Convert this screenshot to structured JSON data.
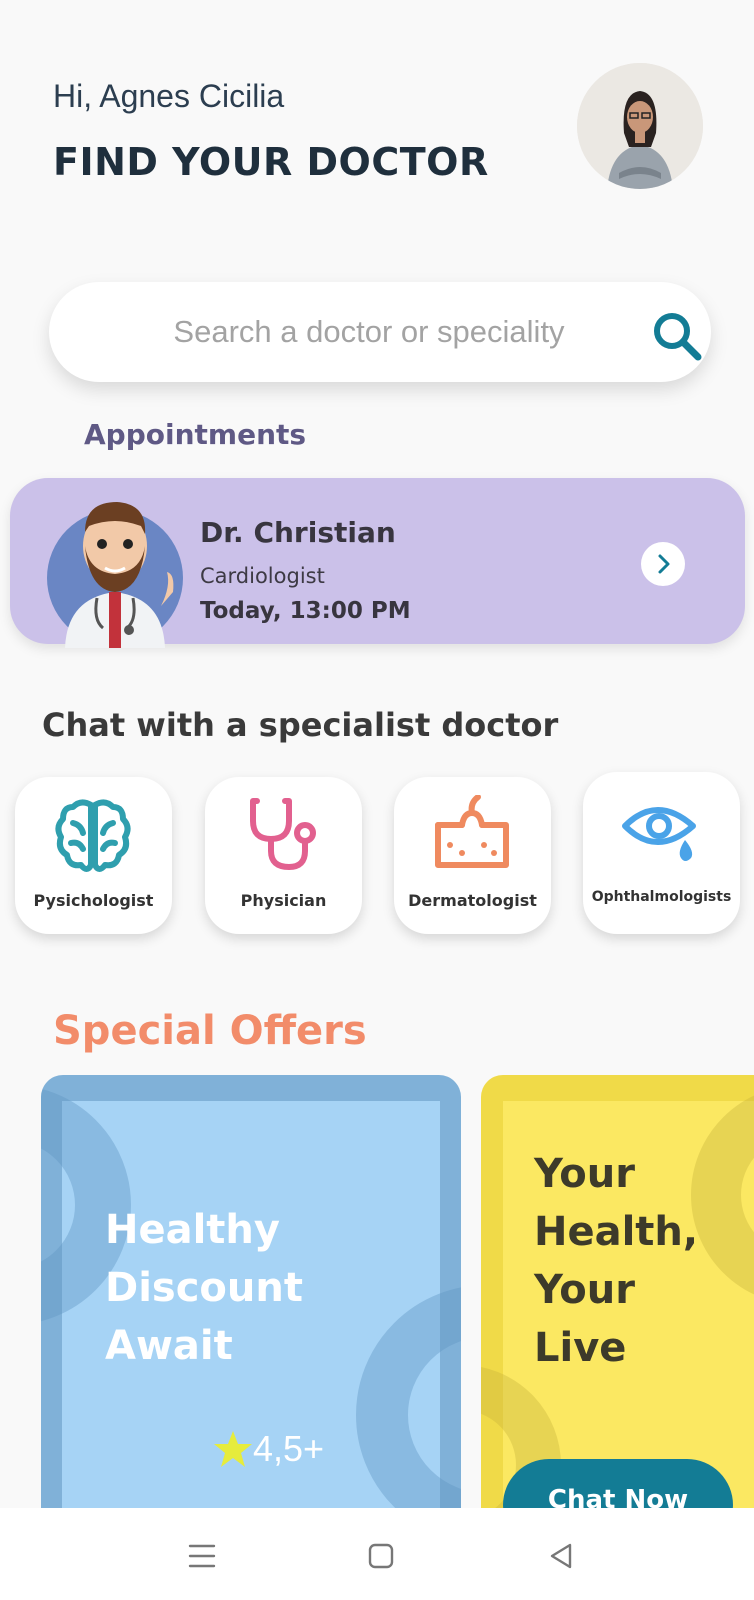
{
  "header": {
    "greeting": "Hi, Agnes Cicilia",
    "title": "FIND YOUR DOCTOR",
    "avatar_icon": "user-avatar"
  },
  "search": {
    "placeholder": "Search a doctor or speciality",
    "icon": "search-icon"
  },
  "appointments": {
    "heading": "Appointments",
    "card": {
      "doctor_name": "Dr. Christian",
      "speciality": "Cardiologist",
      "time": "Today, 13:00 PM",
      "arrow_icon": "chevron-right-icon"
    }
  },
  "specialists": {
    "heading": "Chat with a specialist doctor",
    "items": [
      {
        "label": "Pysichologist",
        "icon": "brain-icon",
        "color": "#2f9fae"
      },
      {
        "label": "Physician",
        "icon": "stethoscope-icon",
        "color": "#e2608f"
      },
      {
        "label": "Dermatologist",
        "icon": "skin-icon",
        "color": "#ef8a5f"
      },
      {
        "label": "Ophthalmologists",
        "icon": "eye-icon",
        "color": "#4aa3e8"
      }
    ]
  },
  "offers": {
    "heading": "Special Offers",
    "cards": [
      {
        "lines": [
          "Healthy",
          "Discount",
          "Await"
        ],
        "rating": "4,5+"
      },
      {
        "lines": [
          "Your",
          "Health,",
          "Your",
          "Live"
        ],
        "button": "Chat Now"
      }
    ]
  },
  "navbar": {
    "items": [
      "menu-icon",
      "home-square-icon",
      "back-triangle-icon"
    ]
  },
  "colors": {
    "accent": "#137c95",
    "appointment_card": "#cbc1e9",
    "offers_heading": "#f28c6a"
  }
}
